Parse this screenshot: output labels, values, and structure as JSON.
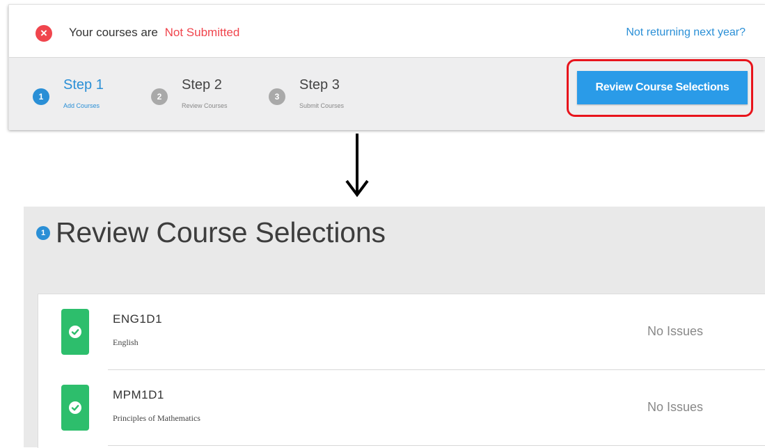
{
  "status": {
    "prefix": "Your courses are",
    "value": "Not Submitted",
    "link": "Not returning next year?",
    "icon": "error-x-icon",
    "colors": {
      "error": "#f0454d",
      "link": "#2a8fd6"
    }
  },
  "steps": [
    {
      "number": "1",
      "title": "Step 1",
      "subtitle": "Add Courses",
      "active": true
    },
    {
      "number": "2",
      "title": "Step 2",
      "subtitle": "Review Courses",
      "active": false
    },
    {
      "number": "3",
      "title": "Step 3",
      "subtitle": "Submit Courses",
      "active": false
    }
  ],
  "review_button": {
    "label": "Review Course Selections",
    "color": "#2a9be8",
    "highlight_color": "#e8141c"
  },
  "arrow": {
    "icon": "down-arrow-icon"
  },
  "review_panel": {
    "badge": "1",
    "heading": "Review Course Selections",
    "courses": [
      {
        "code": "ENG1D1",
        "name": "English",
        "status": "No Issues",
        "icon": "check-icon"
      },
      {
        "code": "MPM1D1",
        "name": "Principles of Mathematics",
        "status": "No Issues",
        "icon": "check-icon"
      }
    ],
    "colors": {
      "ok": "#2dbe6c"
    }
  }
}
